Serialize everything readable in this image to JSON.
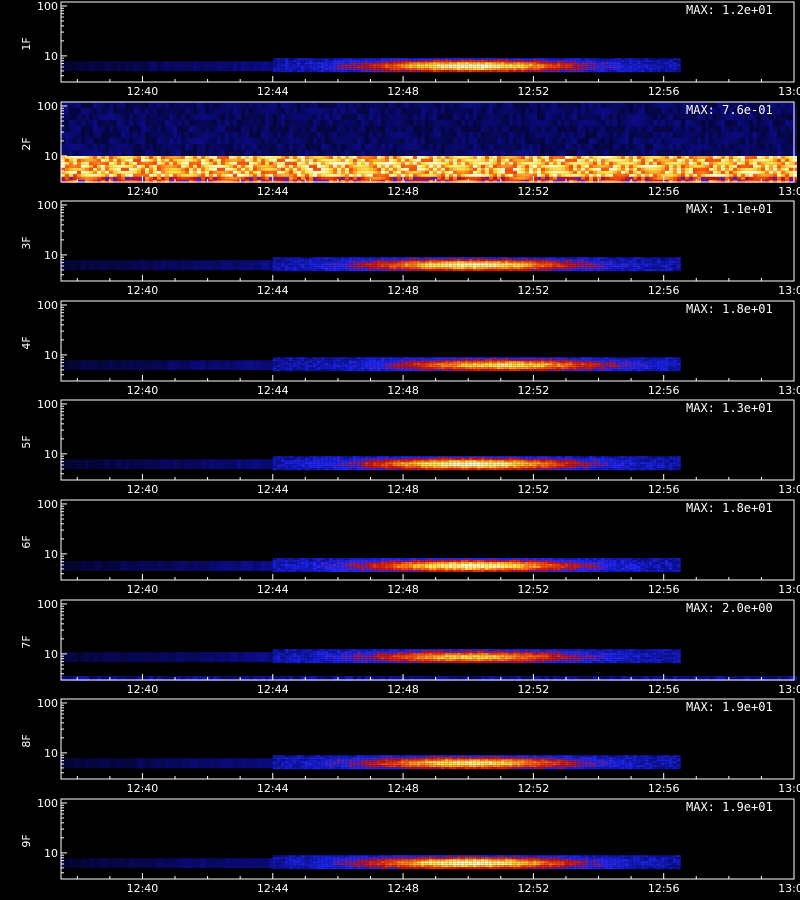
{
  "footer_label": "",
  "colors": {
    "background": "#000000",
    "axis": "#ffffff",
    "colormap": [
      "#000000",
      "#0a0a7a",
      "#1e28ff",
      "#c81414",
      "#ff6010",
      "#ffe040",
      "#ffffd8"
    ]
  },
  "chart_data": [
    {
      "type": "heatmap",
      "ylabel": "1F",
      "max_label": "MAX: 1.2e+01",
      "xlim": [
        "12:37:30",
        "13:00"
      ],
      "ylog": true,
      "yticks": [
        "10",
        "100"
      ],
      "xticks": [
        "12:40",
        "12:44",
        "12:48",
        "12:52",
        "12:56",
        "13:00"
      ],
      "activity": {
        "start": "12:44",
        "end": "12:56:30",
        "peak": "12:50",
        "peak_band": 6.5,
        "intensity": 1.0
      }
    },
    {
      "type": "heatmap",
      "ylabel": "2F",
      "max_label": "MAX: 7.6e-01",
      "xlim": [
        "12:37:30",
        "13:00"
      ],
      "ylog": true,
      "yticks": [
        "10",
        "100"
      ],
      "xticks": [
        "12:40",
        "12:44",
        "12:48",
        "12:52",
        "12:56",
        "13:00"
      ],
      "activity": {
        "start": "12:37:30",
        "end": "13:00",
        "peak": "12:50",
        "peak_band": 5.5,
        "intensity": 1.0,
        "uniform": true
      }
    },
    {
      "type": "heatmap",
      "ylabel": "3F",
      "max_label": "MAX: 1.1e+01",
      "xlim": [
        "12:37:30",
        "13:00"
      ],
      "ylog": true,
      "yticks": [
        "10",
        "100"
      ],
      "xticks": [
        "12:40",
        "12:44",
        "12:48",
        "12:52",
        "12:56",
        "13:00"
      ],
      "activity": {
        "start": "12:44",
        "end": "12:56:30",
        "peak": "12:50",
        "peak_band": 6.5,
        "intensity": 0.95
      }
    },
    {
      "type": "heatmap",
      "ylabel": "4F",
      "max_label": "MAX: 1.8e+01",
      "xlim": [
        "12:37:30",
        "13:00"
      ],
      "ylog": true,
      "yticks": [
        "10",
        "100"
      ],
      "xticks": [
        "12:40",
        "12:44",
        "12:48",
        "12:52",
        "12:56",
        "13:00"
      ],
      "activity": {
        "start": "12:44",
        "end": "12:56:30",
        "peak": "12:51",
        "peak_band": 6.5,
        "intensity": 0.85
      }
    },
    {
      "type": "heatmap",
      "ylabel": "5F",
      "max_label": "MAX: 1.3e+01",
      "xlim": [
        "12:37:30",
        "13:00"
      ],
      "ylog": true,
      "yticks": [
        "10",
        "100"
      ],
      "xticks": [
        "12:40",
        "12:44",
        "12:48",
        "12:52",
        "12:56",
        "13:00"
      ],
      "activity": {
        "start": "12:44",
        "end": "12:56:30",
        "peak": "12:50",
        "peak_band": 6.5,
        "intensity": 1.0
      }
    },
    {
      "type": "heatmap",
      "ylabel": "6F",
      "max_label": "MAX: 1.8e+01",
      "xlim": [
        "12:37:30",
        "13:00"
      ],
      "ylog": true,
      "yticks": [
        "10",
        "100"
      ],
      "xticks": [
        "12:40",
        "12:44",
        "12:48",
        "12:52",
        "12:56",
        "13:00"
      ],
      "activity": {
        "start": "12:44",
        "end": "12:56:30",
        "peak": "12:50",
        "peak_band": 6.0,
        "intensity": 0.95
      }
    },
    {
      "type": "heatmap",
      "ylabel": "7F",
      "max_label": "MAX: 2.0e+00",
      "xlim": [
        "12:37:30",
        "13:00"
      ],
      "ylog": true,
      "yticks": [
        "10",
        "100"
      ],
      "xticks": [
        "12:40",
        "12:44",
        "12:48",
        "12:52",
        "12:56",
        "13:00"
      ],
      "activity": {
        "start": "12:44",
        "end": "12:56:30",
        "peak": "12:50",
        "peak_band": 9.0,
        "intensity": 0.8,
        "noisy": true
      }
    },
    {
      "type": "heatmap",
      "ylabel": "8F",
      "max_label": "MAX: 1.9e+01",
      "xlim": [
        "12:37:30",
        "13:00"
      ],
      "ylog": true,
      "yticks": [
        "10",
        "100"
      ],
      "xticks": [
        "12:40",
        "12:44",
        "12:48",
        "12:52",
        "12:56",
        "13:00"
      ],
      "activity": {
        "start": "12:44",
        "end": "12:56:30",
        "peak": "12:50",
        "peak_band": 6.5,
        "intensity": 0.9
      }
    },
    {
      "type": "heatmap",
      "ylabel": "9F",
      "max_label": "MAX: 1.9e+01",
      "xlim": [
        "12:37:30",
        "13:00"
      ],
      "ylog": true,
      "yticks": [
        "10",
        "100"
      ],
      "xticks": [
        "12:40",
        "12:44",
        "12:48",
        "12:52",
        "12:56",
        "13:00"
      ],
      "activity": {
        "start": "12:44",
        "end": "12:56:30",
        "peak": "12:50",
        "peak_band": 6.5,
        "intensity": 1.0
      }
    }
  ]
}
